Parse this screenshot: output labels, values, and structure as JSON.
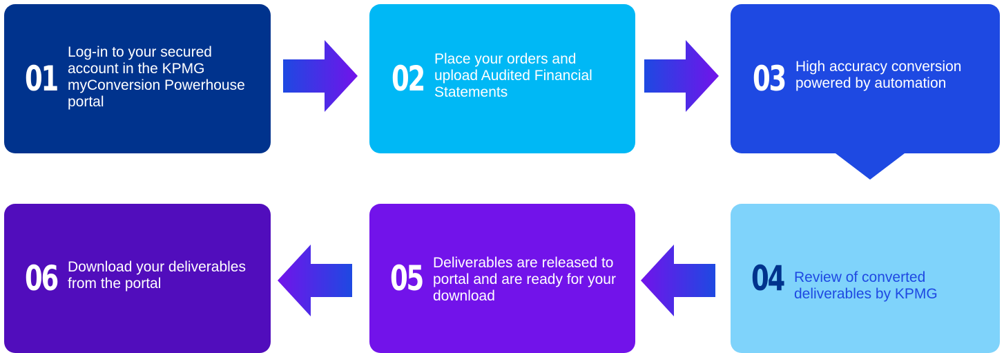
{
  "colors": {
    "kpmg_blue": "#00338d",
    "light_blue": "#00b8f5",
    "cobalt": "#1e49e2",
    "pale_blue": "#7fd3fb",
    "purple": "#7213ea",
    "dark_purple": "#510dbc"
  },
  "steps": [
    {
      "number": "01",
      "text": "Log-in to your secured account in the KPMG myConversion Powerhouse portal"
    },
    {
      "number": "02",
      "text": "Place your orders and upload Audited Financial Statements"
    },
    {
      "number": "03",
      "text": "High accuracy conversion powered by automation"
    },
    {
      "number": "04",
      "text": "Review of converted deliverables by KPMG"
    },
    {
      "number": "05",
      "text": "Deliverables are released to portal and are ready for your download"
    },
    {
      "number": "06",
      "text": "Download your deliverables from the portal"
    }
  ],
  "arrows": [
    {
      "direction": "right",
      "icon": "arrow-right-icon"
    },
    {
      "direction": "right",
      "icon": "arrow-right-icon"
    },
    {
      "direction": "down",
      "icon": "triangle-down-icon"
    },
    {
      "direction": "left",
      "icon": "arrow-left-icon"
    },
    {
      "direction": "left",
      "icon": "arrow-left-icon"
    }
  ]
}
